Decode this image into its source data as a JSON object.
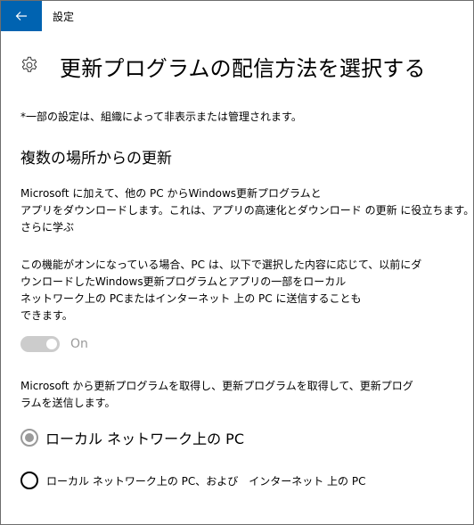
{
  "window": {
    "app_title": "設定"
  },
  "header": {
    "title": "更新プログラムの配信方法を選択する"
  },
  "note": "*一部の設定は、組織によって非表示または管理されます。",
  "section": {
    "heading": "複数の場所からの更新",
    "para1_lines": [
      "Microsoft に加えて、他の PC からWindows更新プログラムと",
      "アプリをダウンロードします。これは、アプリの高速化とダウンロード の更新 に役立ちます。"
    ],
    "learn_more": "さらに学ぶ",
    "para2_lines": [
      "この機能がオンになっている場合、PC は、以下で選択した内容に応じて、以前にダ",
      "ウンロードしたWindows更新プログラムとアプリの一部をローカル",
      "ネットワーク上の PCまたはインターネット 上の PC に送信することも",
      "できます。"
    ],
    "toggle": {
      "label": "On",
      "state": "on",
      "enabled": false
    },
    "para3_lines": [
      "Microsoft から更新プログラムを取得し、更新プログラムを取得して、更新プログ",
      "ラムを送信します。"
    ],
    "radio_options": [
      {
        "label": "ローカル ネットワーク上の PC",
        "selected": true
      },
      {
        "label": "ローカル ネットワーク上の PC、および　インターネット 上の PC",
        "selected": false
      }
    ]
  },
  "colors": {
    "accent": "#0063b1",
    "disabled": "#9a9a9a",
    "toggle_track": "#cccccc"
  },
  "icons": {
    "back": "back-arrow-icon",
    "settings": "gear-icon"
  }
}
